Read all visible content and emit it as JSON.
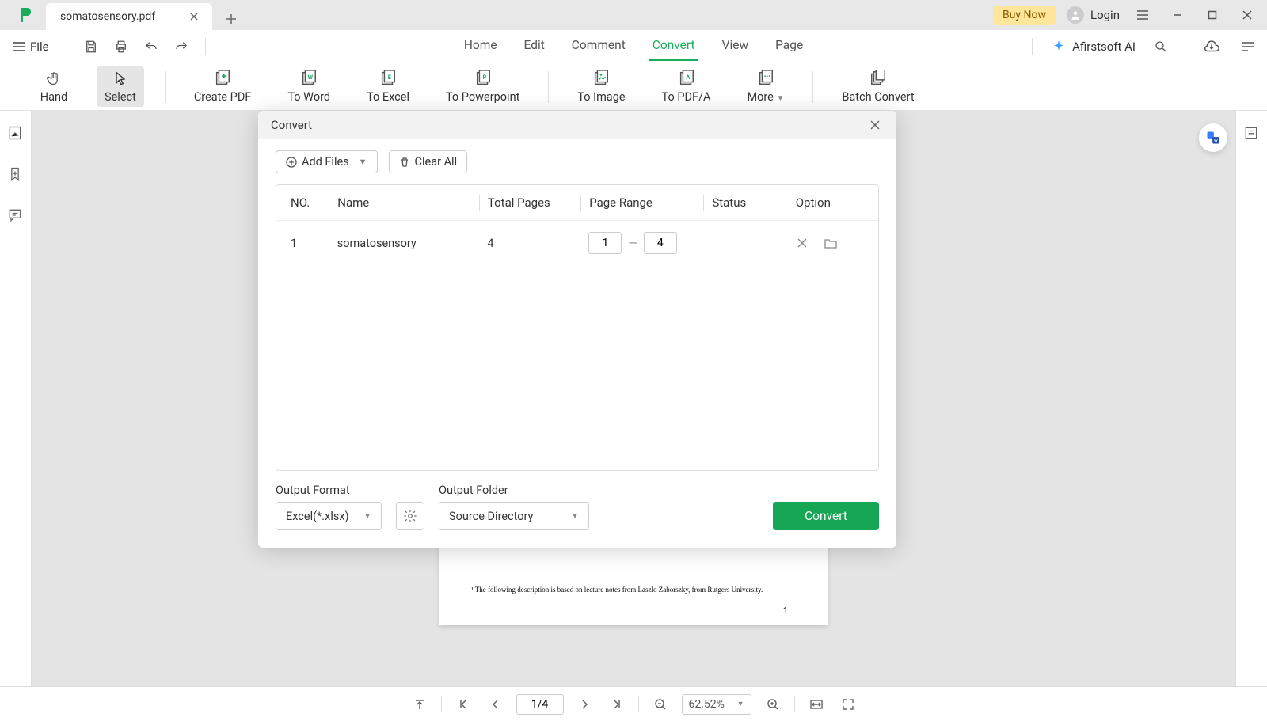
{
  "titlebar": {
    "tab_label": "somatosensory.pdf",
    "buy_now": "Buy Now",
    "login": "Login"
  },
  "toolbar": {
    "file": "File",
    "nav": [
      "Home",
      "Edit",
      "Comment",
      "Convert",
      "View",
      "Page"
    ],
    "active_nav_index": 3,
    "ai_label": "Afirstsoft AI"
  },
  "ribbon": {
    "items": [
      "Hand",
      "Select",
      "Create PDF",
      "To Word",
      "To Excel",
      "To Powerpoint",
      "To Image",
      "To PDF/A",
      "More",
      "Batch Convert"
    ],
    "active_index": 1
  },
  "modal": {
    "title": "Convert",
    "add_files": "Add Files",
    "clear_all": "Clear All",
    "columns": {
      "no": "NO.",
      "name": "Name",
      "total": "Total Pages",
      "range": "Page Range",
      "status": "Status",
      "option": "Option"
    },
    "rows": [
      {
        "no": "1",
        "name": "somatosensory",
        "total": "4",
        "range_from": "1",
        "range_to": "4",
        "status": ""
      }
    ],
    "output_format_label": "Output Format",
    "output_format_value": "Excel(*.xlsx)",
    "output_folder_label": "Output Folder",
    "output_folder_value": "Source Directory",
    "convert_btn": "Convert"
  },
  "document": {
    "footnote": "¹ The following description is based on lecture notes from Laszlo Zaborszky, from Rutgers University.",
    "page_number": "1"
  },
  "statusbar": {
    "page": "1/4",
    "zoom": "62.52%"
  }
}
